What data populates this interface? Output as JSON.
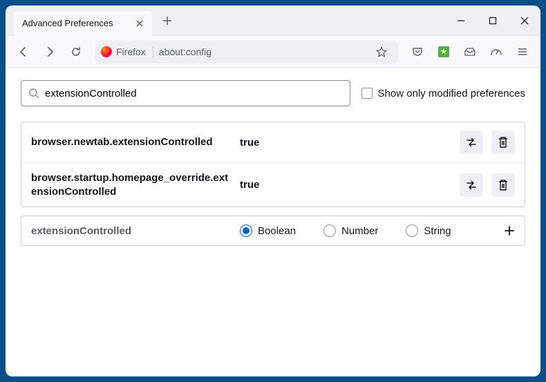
{
  "titlebar": {
    "tab_title": "Advanced Preferences"
  },
  "toolbar": {
    "identity_label": "Firefox",
    "url": "about:config"
  },
  "search": {
    "value": "extensionControlled",
    "show_modified_label": "Show only modified preferences",
    "show_modified_checked": false
  },
  "prefs": [
    {
      "name": "browser.newtab.extensionControlled",
      "value": "true"
    },
    {
      "name": "browser.startup.homepage_override.extensionControlled",
      "value": "true"
    }
  ],
  "new_pref": {
    "name": "extensionControlled",
    "types": [
      "Boolean",
      "Number",
      "String"
    ],
    "selected": "Boolean"
  }
}
